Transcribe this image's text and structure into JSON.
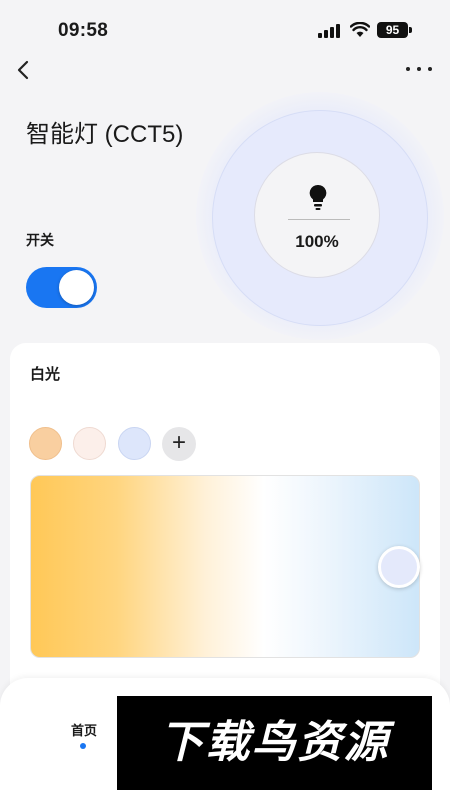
{
  "status_bar": {
    "time": "09:58",
    "battery": "95"
  },
  "header": {
    "title": "智能灯 (CCT5)"
  },
  "dial": {
    "brightness": "100%",
    "brightness_value": 1.0
  },
  "power": {
    "label": "开关",
    "on": true
  },
  "white_light": {
    "title": "白光",
    "presets": [
      {
        "color": "#f9cfa0"
      },
      {
        "color": "#fcefea"
      },
      {
        "color": "#dde6fb"
      }
    ],
    "add_label": "+",
    "gradient_colors": [
      "#ffc857",
      "#ffffff",
      "#cde6f9"
    ],
    "selected_position": 0.95
  },
  "bottom_nav": {
    "home": "首页"
  },
  "watermark": {
    "text": "下载鸟资源"
  },
  "colors": {
    "accent": "#1976f2",
    "background": "#f4f4f6"
  }
}
